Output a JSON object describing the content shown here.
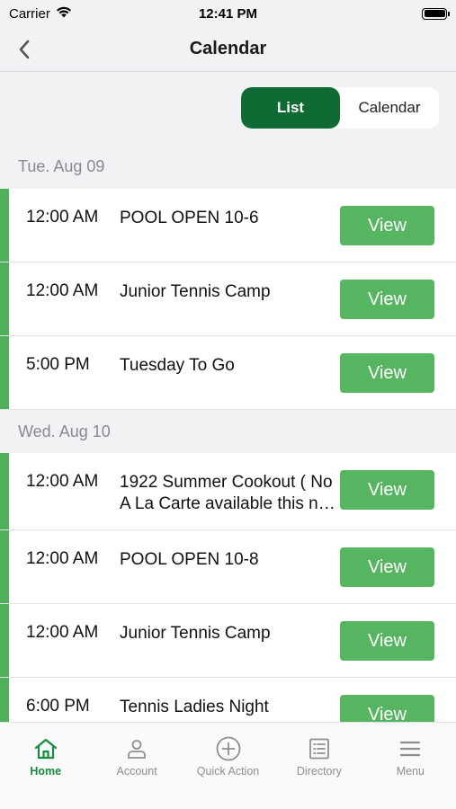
{
  "status_bar": {
    "carrier": "Carrier",
    "time": "12:41 PM"
  },
  "nav": {
    "title": "Calendar"
  },
  "segment": {
    "list_label": "List",
    "calendar_label": "Calendar"
  },
  "days": [
    {
      "header": "Tue. Aug 09",
      "events": [
        {
          "time": "12:00 AM",
          "title": "POOL OPEN 10-6",
          "button": "View"
        },
        {
          "time": "12:00 AM",
          "title": "Junior Tennis Camp",
          "button": "View"
        },
        {
          "time": "5:00 PM",
          "title": "Tuesday To Go",
          "button": "View"
        }
      ]
    },
    {
      "header": "Wed. Aug 10",
      "events": [
        {
          "time": "12:00 AM",
          "title": "1922 Summer Cookout ( No A La Carte available this n…",
          "button": "View"
        },
        {
          "time": "12:00 AM",
          "title": "POOL OPEN 10-8",
          "button": "View"
        },
        {
          "time": "12:00 AM",
          "title": "Junior Tennis Camp",
          "button": "View"
        },
        {
          "time": "6:00 PM",
          "title": "Tennis Ladies Night",
          "button": "View"
        }
      ]
    }
  ],
  "tabs": [
    {
      "label": "Home",
      "icon": "home-icon",
      "active": true
    },
    {
      "label": "Account",
      "icon": "person-icon",
      "active": false
    },
    {
      "label": "Quick Action",
      "icon": "plus-circle-icon",
      "active": false
    },
    {
      "label": "Directory",
      "icon": "list-icon",
      "active": false
    },
    {
      "label": "Menu",
      "icon": "menu-icon",
      "active": false
    }
  ],
  "colors": {
    "accent": "#0e6b34",
    "button": "#56b560",
    "stripe": "#4fb05b",
    "active_tab": "#178a3f"
  }
}
